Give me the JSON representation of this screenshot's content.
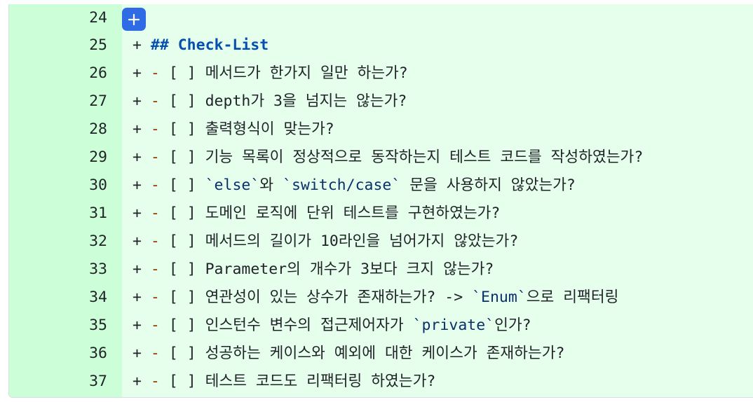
{
  "diff": {
    "add_comment_button_label": "+",
    "lines": [
      {
        "num": "24",
        "marker": "",
        "dash": "",
        "box": "",
        "segments": []
      },
      {
        "num": "25",
        "marker": "+",
        "dash": "",
        "box": "",
        "segments": [
          {
            "t": "## Check-List",
            "k": "heading"
          }
        ]
      },
      {
        "num": "26",
        "marker": "+",
        "dash": "-",
        "box": "[ ]",
        "segments": [
          {
            "t": "메서드가 한가지 일만 하는가?",
            "k": "text"
          }
        ]
      },
      {
        "num": "27",
        "marker": "+",
        "dash": "-",
        "box": "[ ]",
        "segments": [
          {
            "t": "depth가 3을 넘지는 않는가?",
            "k": "text"
          }
        ]
      },
      {
        "num": "28",
        "marker": "+",
        "dash": "-",
        "box": "[ ]",
        "segments": [
          {
            "t": "출력형식이 맞는가?",
            "k": "text"
          }
        ]
      },
      {
        "num": "29",
        "marker": "+",
        "dash": "-",
        "box": "[ ]",
        "segments": [
          {
            "t": "기능 목록이 정상적으로 동작하는지 테스트 코드를 작성하였는가?",
            "k": "text"
          }
        ]
      },
      {
        "num": "30",
        "marker": "+",
        "dash": "-",
        "box": "[ ]",
        "segments": [
          {
            "t": "`else`",
            "k": "code"
          },
          {
            "t": "와 ",
            "k": "text"
          },
          {
            "t": "`switch/case`",
            "k": "code"
          },
          {
            "t": " 문을 사용하지 않았는가?",
            "k": "text"
          }
        ]
      },
      {
        "num": "31",
        "marker": "+",
        "dash": "-",
        "box": "[ ]",
        "segments": [
          {
            "t": "도메인 로직에 단위 테스트를 구현하였는가?",
            "k": "text"
          }
        ]
      },
      {
        "num": "32",
        "marker": "+",
        "dash": "-",
        "box": "[ ]",
        "segments": [
          {
            "t": "메서드의 길이가 10라인을 넘어가지 않았는가?",
            "k": "text"
          }
        ]
      },
      {
        "num": "33",
        "marker": "+",
        "dash": "-",
        "box": "[ ]",
        "segments": [
          {
            "t": "Parameter의 개수가 3보다 크지 않는가?",
            "k": "text"
          }
        ]
      },
      {
        "num": "34",
        "marker": "+",
        "dash": "-",
        "box": "[ ]",
        "segments": [
          {
            "t": "연관성이 있는 상수가 존재하는가? -> ",
            "k": "text"
          },
          {
            "t": "`Enum`",
            "k": "code"
          },
          {
            "t": "으로 리팩터링",
            "k": "text"
          }
        ]
      },
      {
        "num": "35",
        "marker": "+",
        "dash": "-",
        "box": "[ ]",
        "segments": [
          {
            "t": "인스턴수 변수의 접근제어자가 ",
            "k": "text"
          },
          {
            "t": "`private`",
            "k": "code"
          },
          {
            "t": "인가?",
            "k": "text"
          }
        ]
      },
      {
        "num": "36",
        "marker": "+",
        "dash": "-",
        "box": "[ ]",
        "segments": [
          {
            "t": "성공하는 케이스와 예외에 대한 케이스가 존재하는가?",
            "k": "text"
          }
        ]
      },
      {
        "num": "37",
        "marker": "+",
        "dash": "-",
        "box": "[ ]",
        "segments": [
          {
            "t": "테스트 코드도 리팩터링 하였는가?",
            "k": "text"
          }
        ]
      }
    ]
  }
}
